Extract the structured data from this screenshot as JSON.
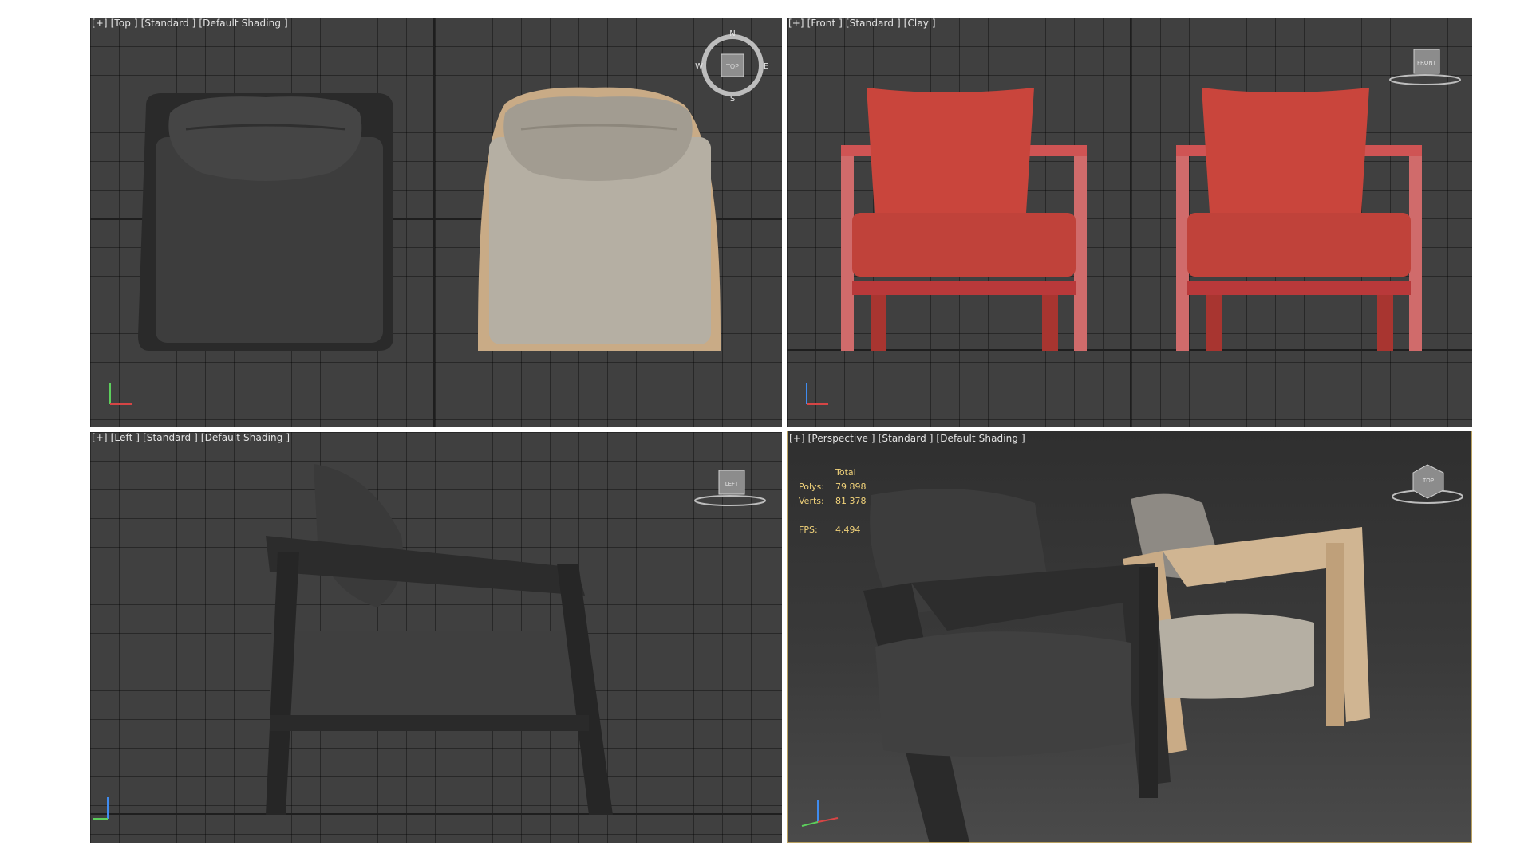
{
  "viewports": {
    "top": {
      "label": "[+] [Top ] [Standard ] [Default Shading ]"
    },
    "front": {
      "label": "[+] [Front ] [Standard ] [Clay ]"
    },
    "left": {
      "label": "[+] [Left ] [Standard ] [Default Shading ]"
    },
    "perspective": {
      "label": "[+] [Perspective ] [Standard ] [Default Shading ]"
    }
  },
  "compass": {
    "n": "N",
    "s": "S",
    "e": "E",
    "w": "W",
    "center": "TOP"
  },
  "viewcubes": {
    "front": "FRONT",
    "left": "LEFT",
    "perspective": "TOP"
  },
  "stats": {
    "header": "Total",
    "polys_label": "Polys:",
    "polys_value": "79 898",
    "verts_label": "Verts:",
    "verts_value": "81 378",
    "fps_label": "FPS:",
    "fps_value": "4,494"
  },
  "colors": {
    "clay": "#c9453c",
    "dark_fabric": "#3a3a3a",
    "light_fabric": "#b5afa3",
    "light_wood": "#c9ab86",
    "active_border": "#b8a060",
    "stats_text": "#f2d37a"
  }
}
